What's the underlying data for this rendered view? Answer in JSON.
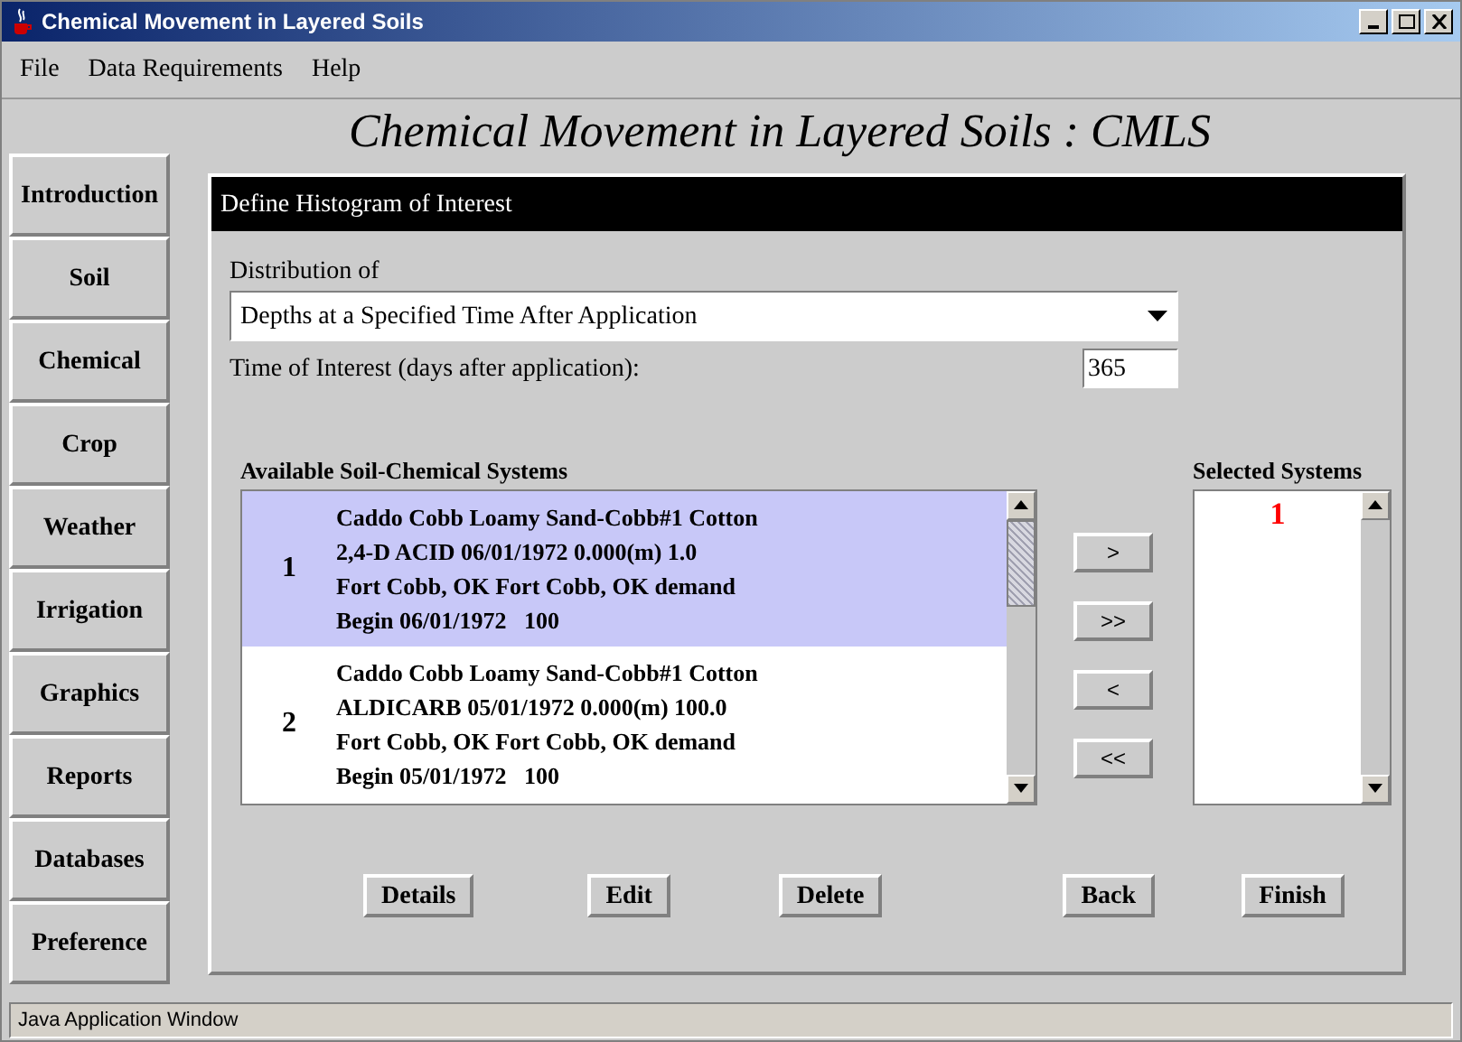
{
  "window": {
    "title": "Chemical Movement in Layered Soils"
  },
  "menu": [
    "File",
    "Data Requirements",
    "Help"
  ],
  "app_title": "Chemical Movement in Layered Soils : CMLS",
  "sidebar": {
    "items": [
      {
        "label": "Introduction"
      },
      {
        "label": "Soil"
      },
      {
        "label": "Chemical"
      },
      {
        "label": "Crop"
      },
      {
        "label": "Weather"
      },
      {
        "label": "Irrigation"
      },
      {
        "label": "Graphics"
      },
      {
        "label": "Reports"
      },
      {
        "label": "Databases"
      },
      {
        "label": "Preference"
      }
    ]
  },
  "panel": {
    "title": "Define Histogram of Interest",
    "distribution": {
      "label": "Distribution of",
      "value": "Depths at a Specified Time After Application"
    },
    "time": {
      "label": "Time of Interest (days after application):",
      "value": "365"
    },
    "available": {
      "label": "Available Soil-Chemical Systems",
      "rows": [
        {
          "number": "1",
          "selected": true,
          "lines": [
            "Caddo Cobb Loamy Sand-Cobb#1 Cotton",
            "2,4-D ACID 06/01/1972 0.000(m) 1.0",
            "Fort Cobb, OK Fort Cobb, OK demand",
            "Begin 06/01/1972   100"
          ]
        },
        {
          "number": "2",
          "selected": false,
          "lines": [
            "Caddo Cobb Loamy Sand-Cobb#1 Cotton",
            "ALDICARB 05/01/1972 0.000(m) 100.0",
            "Fort Cobb, OK Fort Cobb, OK demand",
            "Begin 05/01/1972   100"
          ]
        }
      ]
    },
    "move_buttons": [
      ">",
      ">>",
      "<",
      "<<"
    ],
    "selected_systems": {
      "label": "Selected Systems",
      "items": [
        "1"
      ]
    },
    "buttons": [
      "Details",
      "Edit",
      "Delete",
      "Back",
      "Finish"
    ]
  },
  "status_bar": "Java Application Window"
}
